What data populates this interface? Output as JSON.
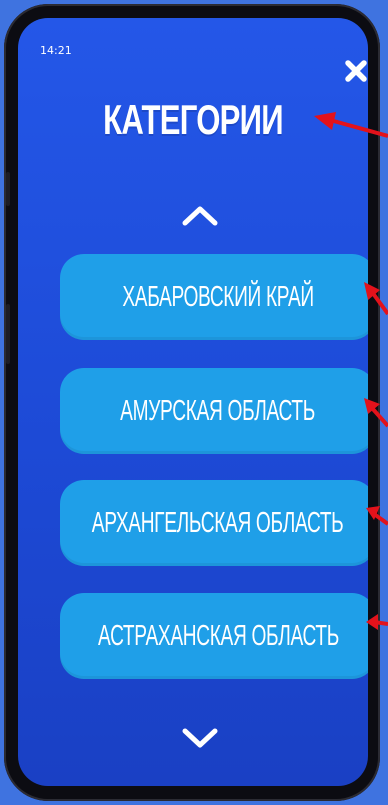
{
  "status_bar": {
    "time": "14:21"
  },
  "header": {
    "title": "КАТЕГОРИИ"
  },
  "controls": {
    "close_icon": "close-icon",
    "scroll_up_icon": "chevron-up-icon",
    "scroll_down_icon": "chevron-down-icon"
  },
  "categories": [
    {
      "label": "ХАБАРОВСКИЙ КРАЙ"
    },
    {
      "label": "АМУРСКАЯ ОБЛАСТЬ"
    },
    {
      "label": "АРХАНГЕЛЬСКАЯ ОБЛАСТЬ"
    },
    {
      "label": "АСТРАХАНСКАЯ ОБЛАСТЬ"
    }
  ],
  "colors": {
    "page_background": "#3f73e0",
    "screen_background": "#1f4fdc",
    "button_background": "#1f9fe8",
    "text": "#ffffff",
    "annotation_arrow": "#e3121b"
  }
}
